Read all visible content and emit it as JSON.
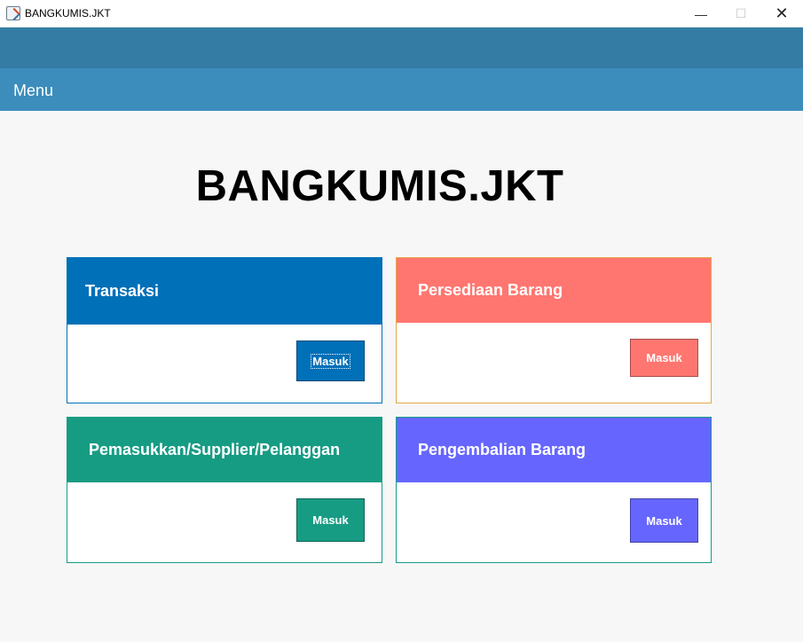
{
  "window": {
    "title": "BANGKUMIS.JKT",
    "minimize_glyph": "—",
    "maximize_glyph": "☐",
    "close_glyph": "✕"
  },
  "menu": {
    "label": "Menu"
  },
  "main": {
    "title": "BANGKUMIS.JKT"
  },
  "cards": [
    {
      "title": "Transaksi",
      "button": "Masuk",
      "color": "#0070b8"
    },
    {
      "title": "Persediaan Barang",
      "button": "Masuk",
      "color": "#ff7670"
    },
    {
      "title": "Pemasukkan/Supplier/Pelanggan",
      "button": "Masuk",
      "color": "#179c84"
    },
    {
      "title": "Pengembalian Barang",
      "button": "Masuk",
      "color": "#6666ff"
    }
  ]
}
